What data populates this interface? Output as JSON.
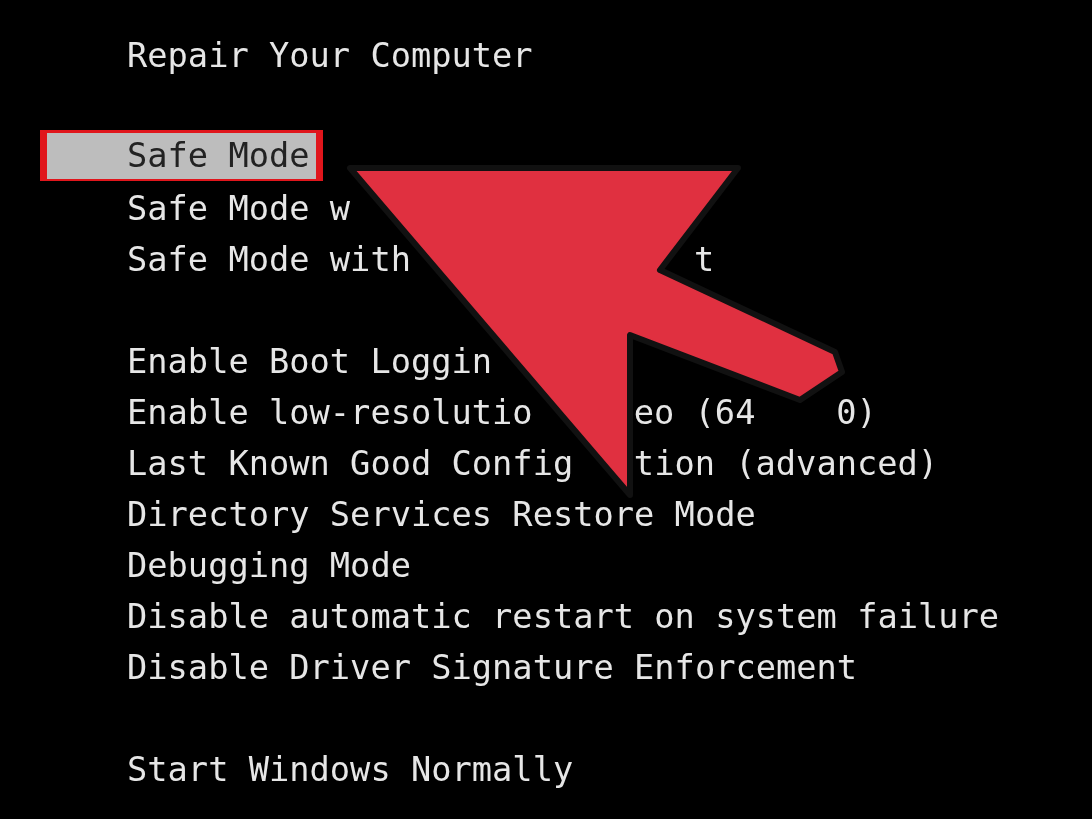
{
  "groups": [
    [
      {
        "segments": [
          "Repair Your Computer"
        ],
        "selected": false
      }
    ],
    [
      {
        "segments": [
          "Safe Mode"
        ],
        "selected": true
      },
      {
        "segments": [
          "Safe Mode w"
        ],
        "selected": false
      },
      {
        "segments": [
          "Safe Mode with",
          "t"
        ],
        "selected": false
      }
    ],
    [
      {
        "segments": [
          "Enable Boot Loggin"
        ],
        "selected": false
      },
      {
        "segments": [
          "Enable low-resolutio",
          "eo (64",
          "0)"
        ],
        "selected": false
      },
      {
        "segments": [
          "Last Known Good Config",
          "tion (advanced)"
        ],
        "selected": false
      },
      {
        "segments": [
          "Directory Services Restore Mode"
        ],
        "selected": false
      },
      {
        "segments": [
          "Debugging Mode"
        ],
        "selected": false
      },
      {
        "segments": [
          "Disable automatic restart on system failure"
        ],
        "selected": false
      },
      {
        "segments": [
          "Disable Driver Signature Enforcement"
        ],
        "selected": false
      }
    ],
    [
      {
        "segments": [
          "Start Windows Normally"
        ],
        "selected": false
      }
    ]
  ]
}
